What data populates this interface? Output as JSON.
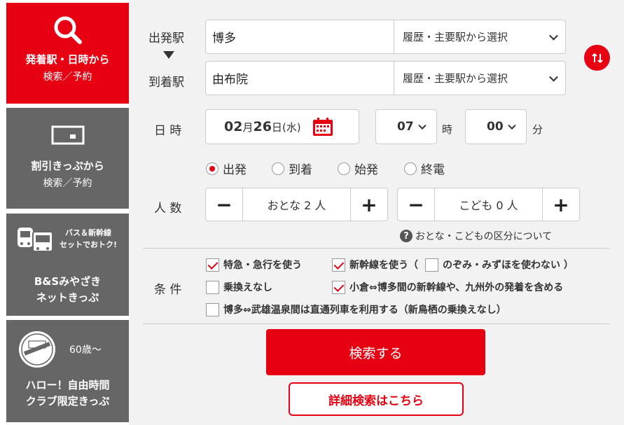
{
  "sidebar": {
    "tabs": [
      {
        "main": "発着駅・日時から",
        "sub": "検索／予約",
        "icon": "search-icon"
      },
      {
        "main": "割引きっぷから",
        "sub": "検索／予約",
        "icon": "ticket-icon"
      },
      {
        "main": "B&Sみやざき",
        "sub": "ネットきっぷ",
        "badge1": "バス＆新幹線",
        "badge2": "セットでおトク!",
        "icon": "bus-train-icon"
      },
      {
        "main": "ハロー！自由時間",
        "sub": "クラブ限定きっぷ",
        "age": "60歳～",
        "icon": "club-stamp-icon"
      }
    ]
  },
  "form": {
    "departure_label": "出発駅",
    "arrival_label": "到着駅",
    "departure_value": "博多",
    "arrival_value": "由布院",
    "select_placeholder": "履歴・主要駅から選択",
    "datetime_label": "日 時",
    "date_month": "02",
    "date_month_unit": "月",
    "date_day": "26",
    "date_day_unit": "日",
    "date_weekday": "(水)",
    "hour": "07",
    "hour_unit": "時",
    "minute": "00",
    "minute_unit": "分",
    "time_options": [
      {
        "label": "出発",
        "selected": true
      },
      {
        "label": "到着",
        "selected": false
      },
      {
        "label": "始発",
        "selected": false
      },
      {
        "label": "終電",
        "selected": false
      }
    ],
    "people_label": "人 数",
    "adult_label": "おとな 2 人",
    "child_label": "こども 0 人",
    "age_help": "おとな・こどもの区分について",
    "conditions_label": "条 件",
    "conditions": [
      {
        "label": "特急・急行を使う",
        "checked": true
      },
      {
        "label": "新幹線を使う（",
        "checked": true
      },
      {
        "label": "のぞみ・みずほを使わない ）",
        "checked": false
      },
      {
        "label": "乗換えなし",
        "checked": false
      },
      {
        "label": "小倉⇔博多間の新幹線や、九州外の発着を含める",
        "checked": true
      },
      {
        "label": "博多⇔武雄温泉間は直通列車を利用する（新鳥栖の乗換えなし）",
        "checked": false
      }
    ],
    "search_label": "検索する",
    "detail_label": "詳細検索はこちら"
  },
  "colors": {
    "accent": "#e60012",
    "tab_gray": "#666666",
    "panel_bg": "#f2f2f2"
  }
}
